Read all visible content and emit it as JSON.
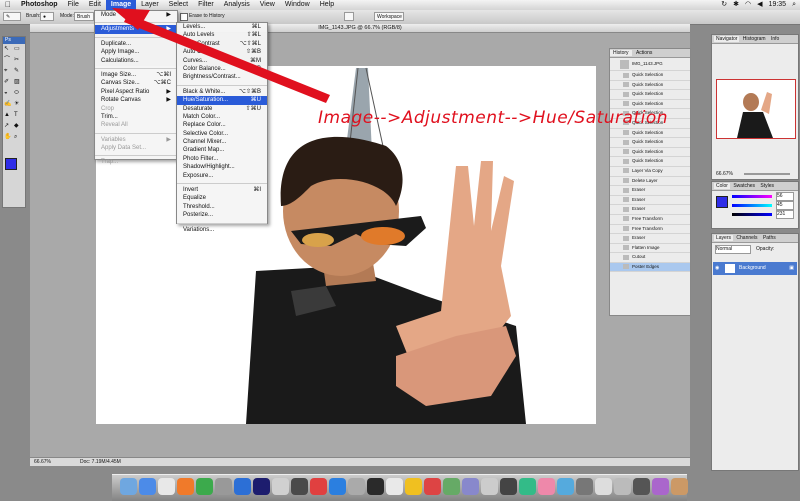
{
  "menubar": {
    "app": "Photoshop",
    "items": [
      "File",
      "Edit",
      "Image",
      "Layer",
      "Select",
      "Filter",
      "Analysis",
      "View",
      "Window",
      "Help"
    ],
    "active": "Image",
    "clock": "19:35"
  },
  "options": {
    "brush_label": "Brush:",
    "mode_label": "Mode:",
    "mode_value": "Brush",
    "erase_to_history": "Erase to History",
    "workspace": "Workspace"
  },
  "document": {
    "title": "IMG_1143.JPG @ 66.7% (RGB/8)",
    "zoom": "66.67%",
    "doc_info": "Doc: 7.19M/4.45M"
  },
  "image_menu": [
    {
      "label": "Mode",
      "arrow": "▶",
      "enabled": true
    },
    {
      "sep": true
    },
    {
      "label": "Adjustments",
      "arrow": "▶",
      "enabled": true,
      "highlight": true
    },
    {
      "sep": true
    },
    {
      "label": "Duplicate...",
      "enabled": true
    },
    {
      "label": "Apply Image...",
      "enabled": true
    },
    {
      "label": "Calculations...",
      "enabled": true
    },
    {
      "sep": true
    },
    {
      "label": "Image Size...",
      "shortcut": "⌥⌘I",
      "enabled": true
    },
    {
      "label": "Canvas Size...",
      "shortcut": "⌥⌘C",
      "enabled": true
    },
    {
      "label": "Pixel Aspect Ratio",
      "arrow": "▶",
      "enabled": true
    },
    {
      "label": "Rotate Canvas",
      "arrow": "▶",
      "enabled": true
    },
    {
      "label": "Crop",
      "enabled": false
    },
    {
      "label": "Trim...",
      "enabled": true
    },
    {
      "label": "Reveal All",
      "enabled": false
    },
    {
      "sep": true
    },
    {
      "label": "Variables",
      "arrow": "▶",
      "enabled": false
    },
    {
      "label": "Apply Data Set...",
      "enabled": false
    },
    {
      "sep": true
    },
    {
      "label": "Trap...",
      "enabled": false
    }
  ],
  "adjust_menu": [
    {
      "label": "Levels...",
      "shortcut": "⌘L"
    },
    {
      "label": "Auto Levels",
      "shortcut": "⇧⌘L"
    },
    {
      "label": "Auto Contrast",
      "shortcut": "⌥⇧⌘L"
    },
    {
      "label": "Auto Color",
      "shortcut": "⇧⌘B"
    },
    {
      "label": "Curves...",
      "shortcut": "⌘M"
    },
    {
      "label": "Color Balance...",
      "shortcut": "⌘B"
    },
    {
      "label": "Brightness/Contrast..."
    },
    {
      "sep": true
    },
    {
      "label": "Black & White...",
      "shortcut": "⌥⇧⌘B"
    },
    {
      "label": "Hue/Saturation...",
      "shortcut": "⌘U",
      "highlight": true
    },
    {
      "label": "Desaturate",
      "shortcut": "⇧⌘U"
    },
    {
      "label": "Match Color..."
    },
    {
      "label": "Replace Color..."
    },
    {
      "label": "Selective Color..."
    },
    {
      "label": "Channel Mixer..."
    },
    {
      "label": "Gradient Map..."
    },
    {
      "label": "Photo Filter..."
    },
    {
      "label": "Shadow/Highlight..."
    },
    {
      "label": "Exposure..."
    },
    {
      "sep": true
    },
    {
      "label": "Invert",
      "shortcut": "⌘I"
    },
    {
      "label": "Equalize"
    },
    {
      "label": "Threshold..."
    },
    {
      "label": "Posterize..."
    },
    {
      "sep": true
    },
    {
      "label": "Variations..."
    }
  ],
  "history": {
    "tabs": [
      "History",
      "Actions"
    ],
    "snapshot": "IMG_1143.JPG",
    "steps": [
      "Quick Selection",
      "Quick Selection",
      "Quick Selection",
      "Quick Selection",
      "Quick Selection",
      "Quick Selection",
      "Quick Selection",
      "Quick Selection",
      "Quick Selection",
      "Quick Selection",
      "Layer Via Copy",
      "Delete Layer",
      "Eraser",
      "Eraser",
      "Eraser",
      "Free Transform",
      "Free Transform",
      "Eraser",
      "Flatten Image",
      "Cutout",
      "Poster Edges"
    ],
    "active_index": 20
  },
  "navigator": {
    "tabs": [
      "Navigator",
      "Histogram",
      "Info"
    ],
    "zoom": "66.67%"
  },
  "color": {
    "tabs": [
      "Color",
      "Swatches",
      "Styles"
    ],
    "r": "56",
    "g": "45",
    "b": "231",
    "fg_color": "#2f2de7"
  },
  "layers": {
    "tabs": [
      "Layers",
      "Channels",
      "Paths"
    ],
    "blend": "Normal",
    "opacity": "Opacity:",
    "layer_name": "Background"
  },
  "annotation": "Image-->Adjustment-->Hue/Saturation",
  "colors": {
    "accent": "#2a5bd8",
    "annotation": "#e0101e"
  }
}
